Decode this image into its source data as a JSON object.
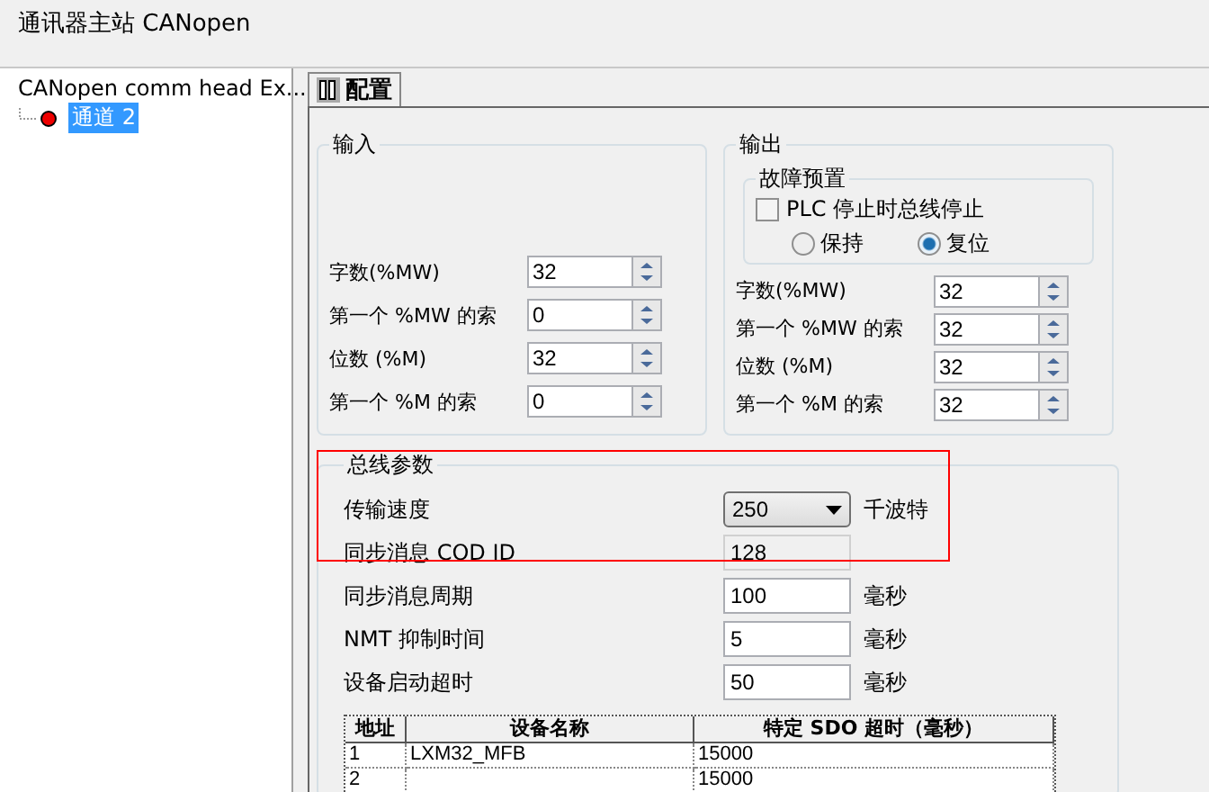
{
  "window": {
    "title": "通讯器主站 CANopen"
  },
  "tree": {
    "items": [
      {
        "label": "CANopen comm head Ex...",
        "children": [
          {
            "label": "通道 2",
            "selected": true
          }
        ]
      }
    ]
  },
  "tabs": [
    {
      "label": "配置",
      "selected": true
    }
  ],
  "input_group": {
    "title": "输入",
    "fields": [
      {
        "label": "字数(%MW)",
        "value": "32"
      },
      {
        "label": "第一个 %MW 的索",
        "value": "0"
      },
      {
        "label": "位数 (%M)",
        "value": "32"
      },
      {
        "label": "第一个 %M 的索",
        "value": "0"
      }
    ]
  },
  "output_group": {
    "title": "输出",
    "fallback": {
      "title": "故障预置",
      "checkbox": {
        "label": "PLC 停止时总线停止",
        "checked": false
      },
      "options": [
        {
          "label": "保持",
          "selected": false
        },
        {
          "label": "复位",
          "selected": true
        }
      ]
    },
    "fields": [
      {
        "label": "字数(%MW)",
        "value": "32"
      },
      {
        "label": "第一个 %MW 的索",
        "value": "32"
      },
      {
        "label": "位数 (%M)",
        "value": "32"
      },
      {
        "label": "第一个 %M 的索",
        "value": "32"
      }
    ]
  },
  "bus_params": {
    "title": "总线参数",
    "highlighted": true,
    "rows": [
      {
        "kind": "dropdown",
        "label": "传输速度",
        "value": "250",
        "unit": "千波特"
      },
      {
        "kind": "readonly",
        "label": "同步消息 COD ID",
        "value": "128"
      },
      {
        "kind": "input",
        "label": "同步消息周期",
        "value": "100",
        "unit": "毫秒"
      },
      {
        "kind": "input",
        "label": "NMT 抑制时间",
        "value": "5",
        "unit": "毫秒"
      },
      {
        "kind": "input",
        "label": "设备启动超时",
        "value": "50",
        "unit": "毫秒"
      }
    ]
  },
  "table": {
    "columns": [
      "地址",
      "设备名称",
      "特定 SDO 超时（毫秒）"
    ],
    "rows": [
      {
        "address": "1",
        "name": "LXM32_MFB",
        "timeout": "15000"
      },
      {
        "address": "2",
        "timeout": "15000"
      }
    ]
  }
}
